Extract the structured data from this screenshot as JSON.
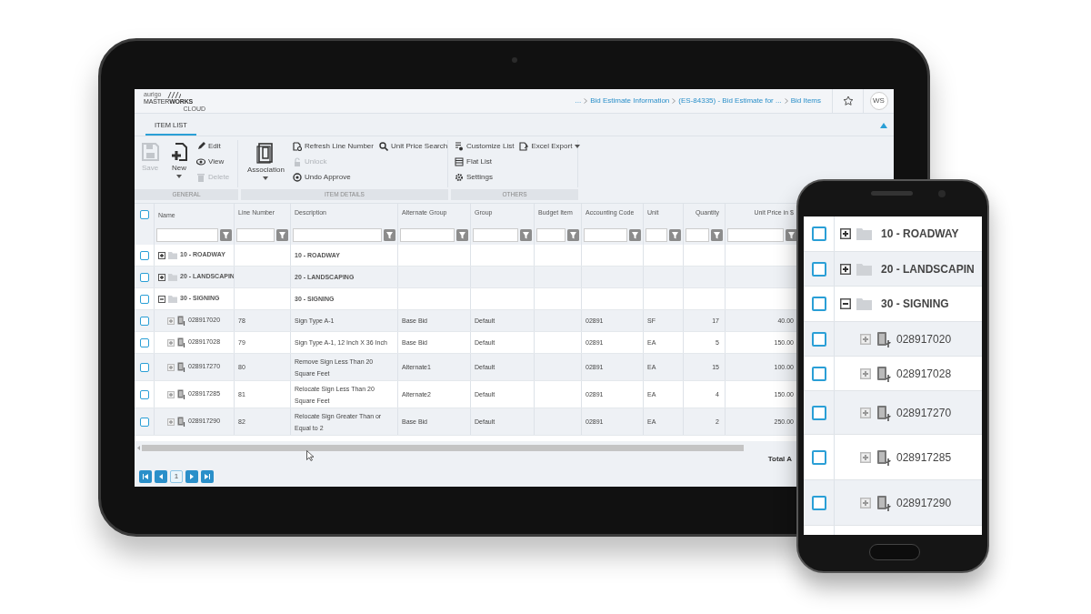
{
  "tablet": {
    "logo": {
      "maker": "aurigo",
      "name": "MASTER",
      "name_bold": "WORKS",
      "sub": "CLOUD"
    },
    "breadcrumbs": [
      "...",
      "Bid Estimate Information",
      "(ES-84335) - Bid Estimate for ...",
      "Bid Items"
    ],
    "avatar": "WS",
    "tabs": [
      {
        "label": "ITEM LIST",
        "selected": true
      }
    ],
    "ribbon": [
      {
        "label": "GENERAL",
        "columns": [
          [
            {
              "kind": "large",
              "label": "Save",
              "disabled": true,
              "dropdown": false
            }
          ],
          [
            {
              "kind": "large",
              "label": "New",
              "disabled": false,
              "dropdown": true
            }
          ],
          [
            {
              "kind": "small",
              "label": "Edit",
              "disabled": false,
              "dropdown": false
            },
            {
              "kind": "small",
              "label": "View",
              "disabled": false,
              "dropdown": false
            },
            {
              "kind": "small",
              "label": "Delete",
              "disabled": true,
              "dropdown": false
            }
          ]
        ]
      },
      {
        "label": "ITEM DETAILS",
        "columns": [
          [
            {
              "kind": "large",
              "label": "Association",
              "disabled": false,
              "dropdown": true
            }
          ],
          [
            {
              "kind": "small",
              "label": "Refresh Line Number",
              "disabled": false,
              "dropdown": false
            },
            {
              "kind": "small",
              "label": "Unlock",
              "disabled": true,
              "dropdown": false
            },
            {
              "kind": "small",
              "label": "Undo Approve",
              "disabled": false,
              "dropdown": false
            }
          ],
          [
            {
              "kind": "small",
              "label": "Unit Price Search",
              "disabled": false,
              "dropdown": false
            }
          ]
        ]
      },
      {
        "label": "OTHERS",
        "columns": [
          [
            {
              "kind": "small",
              "label": "Customize List",
              "disabled": false,
              "dropdown": false
            },
            {
              "kind": "small",
              "label": "Flat List",
              "disabled": false,
              "dropdown": false
            },
            {
              "kind": "small",
              "label": "Settings",
              "disabled": false,
              "dropdown": false
            }
          ],
          [
            {
              "kind": "small",
              "label": "Excel Export",
              "disabled": false,
              "dropdown": true
            }
          ]
        ]
      }
    ],
    "table": {
      "header_checked": false,
      "columns": [
        "Name",
        "Line Number",
        "Description",
        "Alternate Group",
        "Group",
        "Budget Item",
        "Accounting Code",
        "Unit",
        "Quantity",
        "Unit Price in $"
      ],
      "rows": [
        {
          "kind": "group",
          "checked": false,
          "expanded": false,
          "name": "10 - ROADWAY",
          "description": "10 - ROADWAY"
        },
        {
          "kind": "group",
          "checked": false,
          "expanded": false,
          "name": "20 - LANDSCAPIN",
          "description": "20 - LANDSCAPING"
        },
        {
          "kind": "group",
          "checked": false,
          "expanded": true,
          "name": "30 - SIGNING",
          "description": "30 - SIGNING"
        },
        {
          "kind": "item",
          "checked": false,
          "expanded": false,
          "name": "028917020",
          "line": "78",
          "description": "Sign Type A-1",
          "alternate_group": "Base Bid",
          "group": "Default",
          "accounting_code": "02891",
          "unit": "SF",
          "quantity": "17",
          "unit_price": "40.00"
        },
        {
          "kind": "item",
          "checked": false,
          "expanded": false,
          "name": "028917028",
          "line": "79",
          "description": "Sign Type A-1, 12 Inch X 36 Inch",
          "alternate_group": "Base Bid",
          "group": "Default",
          "accounting_code": "02891",
          "unit": "EA",
          "quantity": "5",
          "unit_price": "150.00"
        },
        {
          "kind": "item",
          "checked": false,
          "expanded": false,
          "name": "028917270",
          "line": "80",
          "description": "Remove Sign Less Than 20 Square Feet",
          "alternate_group": "Alternate1",
          "group": "Default",
          "accounting_code": "02891",
          "unit": "EA",
          "quantity": "15",
          "unit_price": "100.00"
        },
        {
          "kind": "item",
          "checked": false,
          "expanded": false,
          "name": "028917285",
          "line": "81",
          "description": "Relocate Sign Less Than 20 Square Feet",
          "alternate_group": "Alternate2",
          "group": "Default",
          "accounting_code": "02891",
          "unit": "EA",
          "quantity": "4",
          "unit_price": "150.00"
        },
        {
          "kind": "item",
          "checked": false,
          "expanded": false,
          "name": "028917290",
          "line": "82",
          "description": "Relocate Sign Greater Than or Equal to 2",
          "alternate_group": "Base Bid",
          "group": "Default",
          "accounting_code": "02891",
          "unit": "EA",
          "quantity": "2",
          "unit_price": "250.00"
        }
      ]
    },
    "total_label": "Total A",
    "pager": {
      "page": "1"
    }
  },
  "phone": {
    "rows": [
      {
        "kind": "group",
        "checked": false,
        "expanded": false,
        "name": "10 - ROADWAY"
      },
      {
        "kind": "group",
        "checked": false,
        "expanded": false,
        "name": "20 - LANDSCAPIN"
      },
      {
        "kind": "group",
        "checked": false,
        "expanded": true,
        "name": "30 - SIGNING"
      },
      {
        "kind": "item",
        "checked": false,
        "expanded": false,
        "name": "028917020"
      },
      {
        "kind": "item",
        "checked": false,
        "expanded": false,
        "name": "028917028"
      },
      {
        "kind": "item",
        "checked": false,
        "expanded": false,
        "name": "028917270"
      },
      {
        "kind": "item",
        "checked": false,
        "expanded": false,
        "name": "028917285"
      },
      {
        "kind": "item",
        "checked": false,
        "expanded": false,
        "name": "028917290"
      }
    ]
  }
}
